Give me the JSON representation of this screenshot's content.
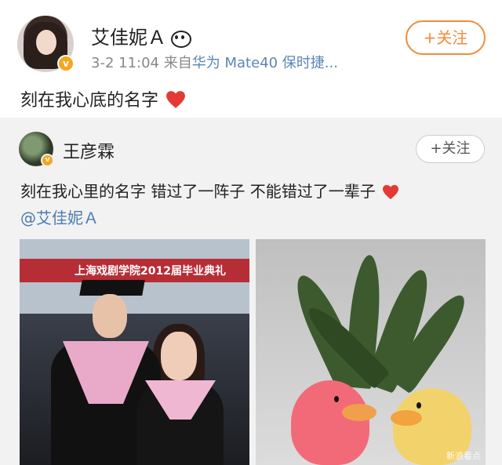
{
  "post": {
    "username": "艾佳妮Ａ",
    "badge": "v",
    "timestamp": "3-2 11:04",
    "source_prefix": "来自",
    "device": "华为 Mate40 保时捷...",
    "follow_label": "+关注",
    "text": "刻在我心底的名字"
  },
  "repost": {
    "username": "王彦霖",
    "badge": "v",
    "follow_label": "+关注",
    "text": "刻在我心里的名字 错过了一阵子 不能错过了一辈子",
    "mention": "@艾佳妮Ａ",
    "photos": [
      {
        "banner_text": "上海戏剧学院2012届毕业典礼"
      },
      {
        "watermark": "新浪看点"
      }
    ]
  },
  "colors": {
    "accent_orange": "#f28b3b",
    "link_blue": "#4a7bb0",
    "device_blue": "#5b86b7",
    "heart_red": "#e53935",
    "verified_badge": "#f5a623"
  },
  "icons": {
    "emoji": "panda-icon",
    "heart": "red-heart-icon"
  }
}
